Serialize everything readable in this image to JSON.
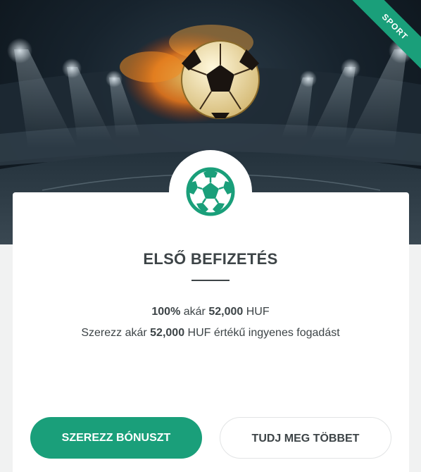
{
  "hero": {
    "ribbon_label": "SPORT"
  },
  "card": {
    "title": "ELSŐ BEFIZETÉS",
    "line1": {
      "percent": "100%",
      "word": "akár",
      "amount": "52,000",
      "currency": "HUF"
    },
    "line2": {
      "prefix": "Szerezz akár",
      "amount": "52,000",
      "suffix": "HUF értékű ingyenes fogadást"
    },
    "primary_button": "SZEREZZ BÓNUSZT",
    "secondary_button": "TUDJ MEG TÖBBET"
  },
  "colors": {
    "accent": "#1a9f7a",
    "text": "#3d4447"
  },
  "icons": {
    "badge": "soccer-ball-icon",
    "hero": "flaming-soccer-ball"
  }
}
